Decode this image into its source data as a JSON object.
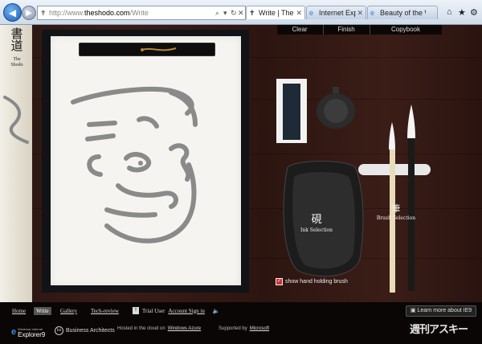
{
  "browser": {
    "url_gray": "http://www.",
    "url_domain": "theshodo.com",
    "url_path": "/Write",
    "tabs": [
      {
        "label": "Write | The Sho...",
        "active": true
      },
      {
        "label": "Internet Explorer ...",
        "active": false
      },
      {
        "label": "Beauty of the Web",
        "active": false
      }
    ]
  },
  "logo": {
    "kanji": "書道",
    "sub": "The Shodo"
  },
  "toolbar": {
    "clear": "Clear",
    "finish": "Finish",
    "copybook": "Copybook"
  },
  "ink": {
    "kanji": "硯",
    "label": "Ink Selection"
  },
  "brush": {
    "kanji": "筆",
    "label": "Brush Selection"
  },
  "checkbox": {
    "label": "show hand holding brush",
    "checked": true
  },
  "nav": {
    "home": "Home",
    "write": "Write",
    "gallery": "Gallery",
    "tech": "Tech-review",
    "trial": "Trial User",
    "account": "Account Sign in",
    "learn": "Learn more about IE9"
  },
  "footer": {
    "ie9": "Explorer9",
    "ie9_small": "Windows Internet",
    "ba": "Business Architects",
    "hosted_pre": "Hosted in the cloud on",
    "azure": "Windows Azure",
    "supported_pre": "Supported by",
    "microsoft": "Microsoft"
  },
  "watermark": "週刊アスキー",
  "colors": {
    "accent": "#1c5fb8",
    "ink_stroke": "#8a8a8a",
    "wood": "#3a1c16"
  }
}
